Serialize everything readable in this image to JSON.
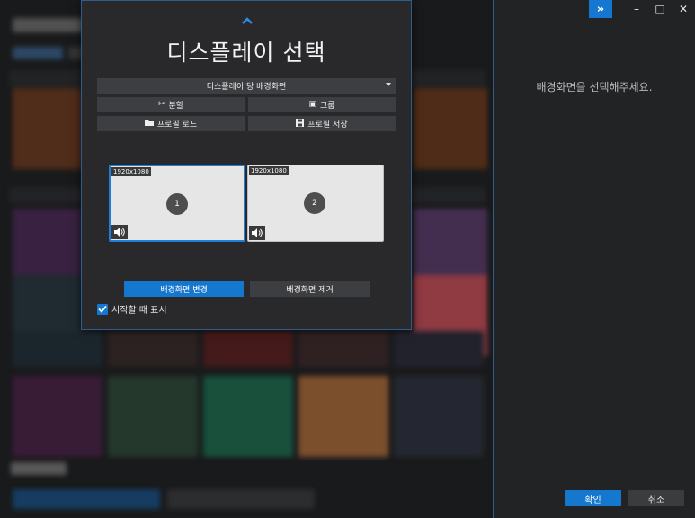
{
  "dialog": {
    "title": "디스플레이 선택",
    "display_mode": "디스플레이 당 배경화면",
    "buttons": {
      "split": "분할",
      "group": "그룹",
      "profile_load": "프로필 로드",
      "profile_save": "프로필 저장"
    },
    "monitors": [
      {
        "number": "1",
        "resolution": "1920x1080",
        "selected": true
      },
      {
        "number": "2",
        "resolution": "1920x1080",
        "selected": false
      }
    ],
    "change_wallpaper": "배경화면 변경",
    "remove_wallpaper": "배경화면 제거",
    "show_on_start": "시작할 때 표시",
    "show_on_start_checked": true
  },
  "side_panel": {
    "message": "배경화면을 선택해주세요.",
    "ok": "확인",
    "cancel": "취소"
  },
  "window_controls": {
    "expand": "»",
    "minimize": "–",
    "maximize": "□",
    "close": "✕"
  },
  "colors": {
    "accent": "#1677cf",
    "dialog_bg": "#29292b",
    "button_bg": "#3d3e41",
    "border": "#2b5d8f"
  },
  "icons": {
    "collapse": "chevron-up-icon",
    "split": "scissors-icon",
    "group": "group-icon",
    "profile_load": "folder-icon",
    "profile_save": "save-icon",
    "speaker": "speaker-icon",
    "checkbox": "check-icon"
  }
}
